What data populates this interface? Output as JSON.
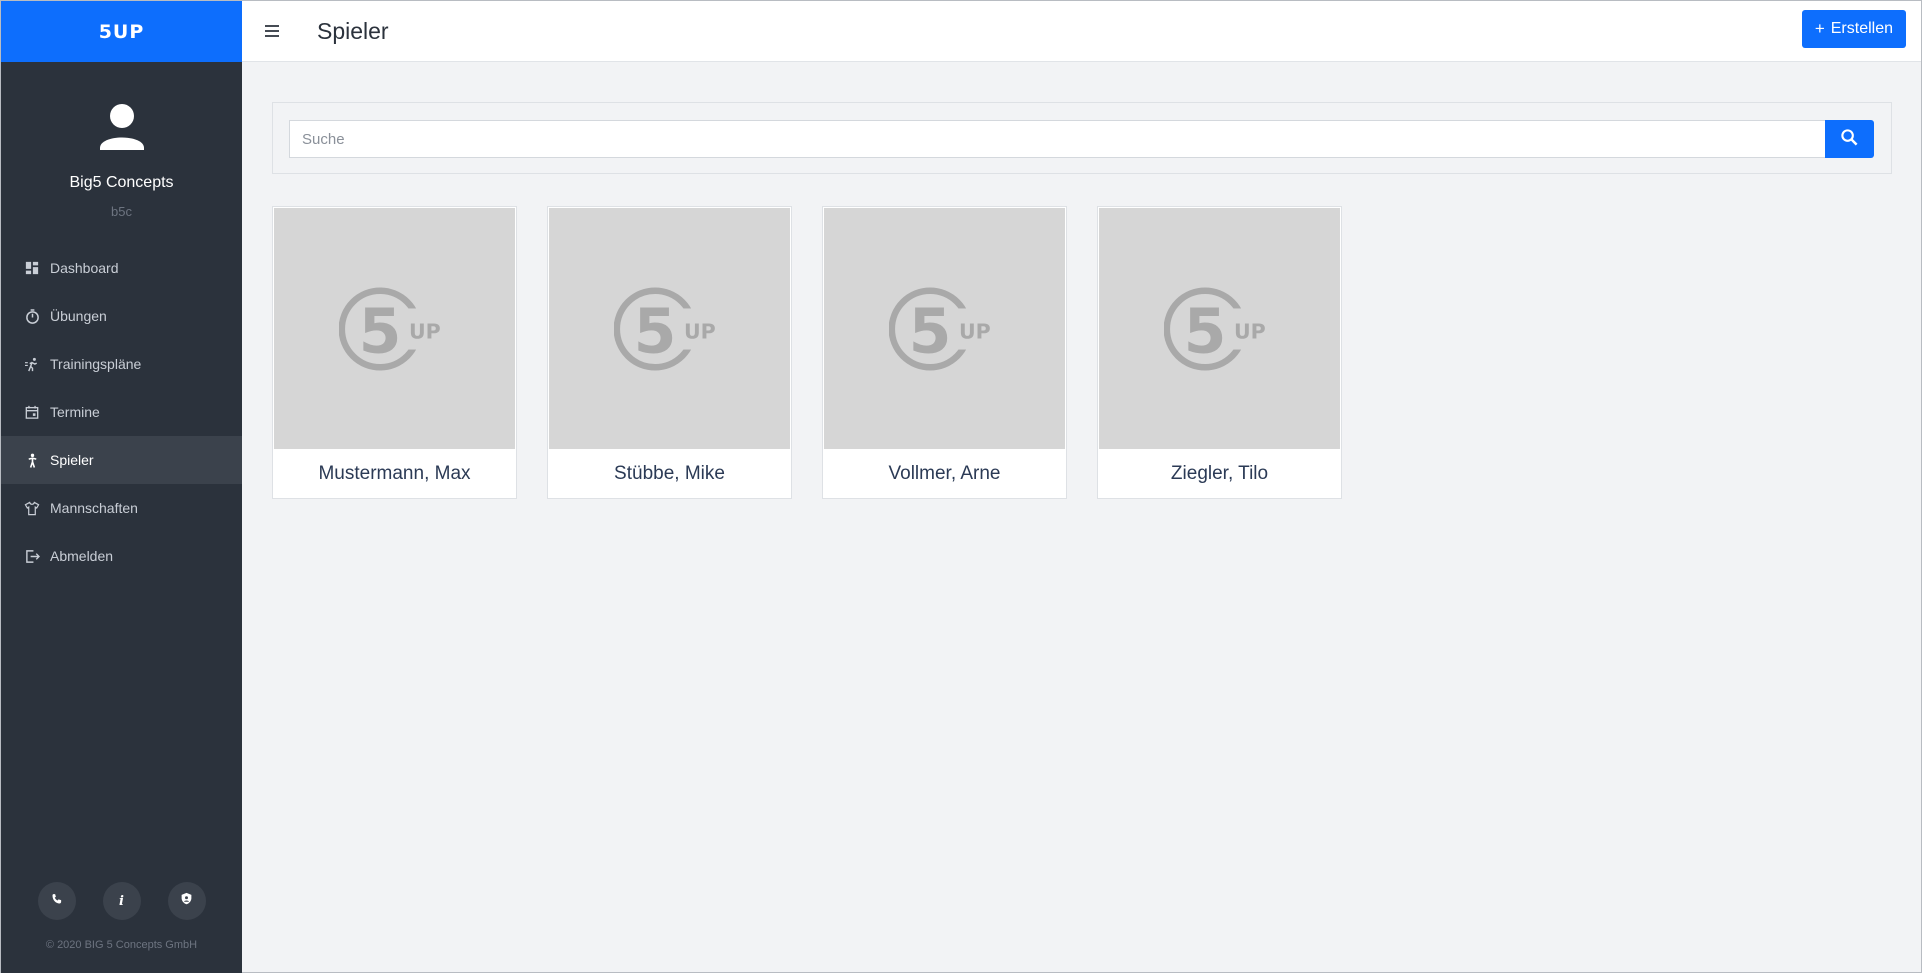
{
  "app": {
    "logo_text": "5UP",
    "brand_color": "#0d6efd"
  },
  "profile": {
    "name": "Big5 Concepts",
    "subtitle": "b5c"
  },
  "sidebar": {
    "items": [
      {
        "label": "Dashboard",
        "icon": "dashboard-icon",
        "active": false
      },
      {
        "label": "Übungen",
        "icon": "timer-icon",
        "active": false
      },
      {
        "label": "Trainingspläne",
        "icon": "running-icon",
        "active": false
      },
      {
        "label": "Termine",
        "icon": "calendar-icon",
        "active": false
      },
      {
        "label": "Spieler",
        "icon": "person-icon",
        "active": true
      },
      {
        "label": "Mannschaften",
        "icon": "shirt-icon",
        "active": false
      },
      {
        "label": "Abmelden",
        "icon": "logout-icon",
        "active": false
      }
    ],
    "footer_icons": [
      "phone-icon",
      "info-icon",
      "shield-icon"
    ],
    "copyright": "© 2020 BIG 5 Concepts GmbH"
  },
  "header": {
    "title": "Spieler",
    "create_label": "Erstellen"
  },
  "search": {
    "placeholder": "Suche",
    "value": ""
  },
  "players": [
    {
      "name": "Mustermann, Max",
      "image_logo": "5UP"
    },
    {
      "name": "Stübbe, Mike",
      "image_logo": "5UP"
    },
    {
      "name": "Vollmer, Arne",
      "image_logo": "5UP"
    },
    {
      "name": "Ziegler, Tilo",
      "image_logo": "5UP"
    }
  ]
}
